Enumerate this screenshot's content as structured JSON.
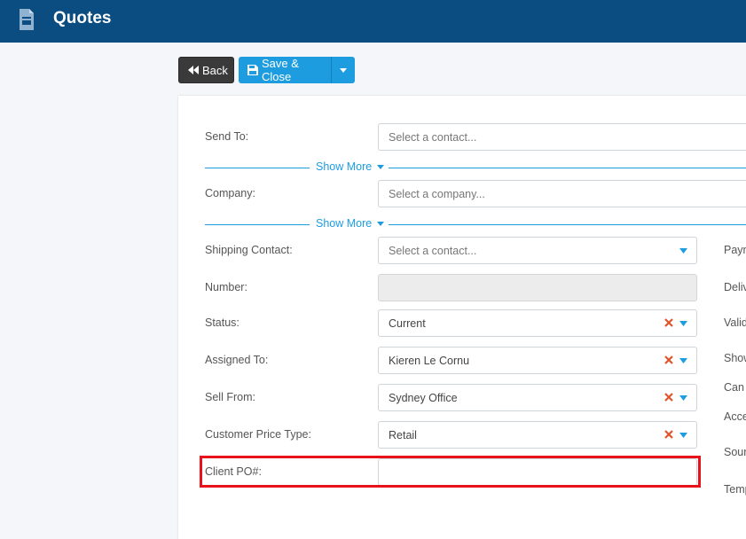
{
  "header": {
    "title": "Quotes",
    "icon": "document-icon",
    "bg_color": "#0b4d80"
  },
  "toolbar": {
    "back_label": "Back",
    "save_close_label": "Save & Close",
    "accent": "#1d9ce0"
  },
  "form": {
    "send_to": {
      "label": "Send To:",
      "placeholder": "Select a contact..."
    },
    "show_more_1": "Show More",
    "company": {
      "label": "Company:",
      "placeholder": "Select a company..."
    },
    "show_more_2": "Show More",
    "shipping_contact": {
      "label": "Shipping Contact:",
      "placeholder": "Select a contact..."
    },
    "number": {
      "label": "Number:",
      "value": ""
    },
    "status": {
      "label": "Status:",
      "value": "Current"
    },
    "assigned_to": {
      "label": "Assigned To:",
      "value": "Kieren Le Cornu"
    },
    "sell_from": {
      "label": "Sell From:",
      "value": "Sydney Office"
    },
    "customer_price_type": {
      "label": "Customer Price Type:",
      "value": "Retail"
    },
    "client_po": {
      "label": "Client PO#:",
      "value": ""
    }
  },
  "right_labels": [
    "Paym",
    "Deliv",
    "Valid",
    "Show",
    "Can A",
    "Acce",
    "Sourc",
    "Temp"
  ],
  "highlight_color": "#e8121b"
}
